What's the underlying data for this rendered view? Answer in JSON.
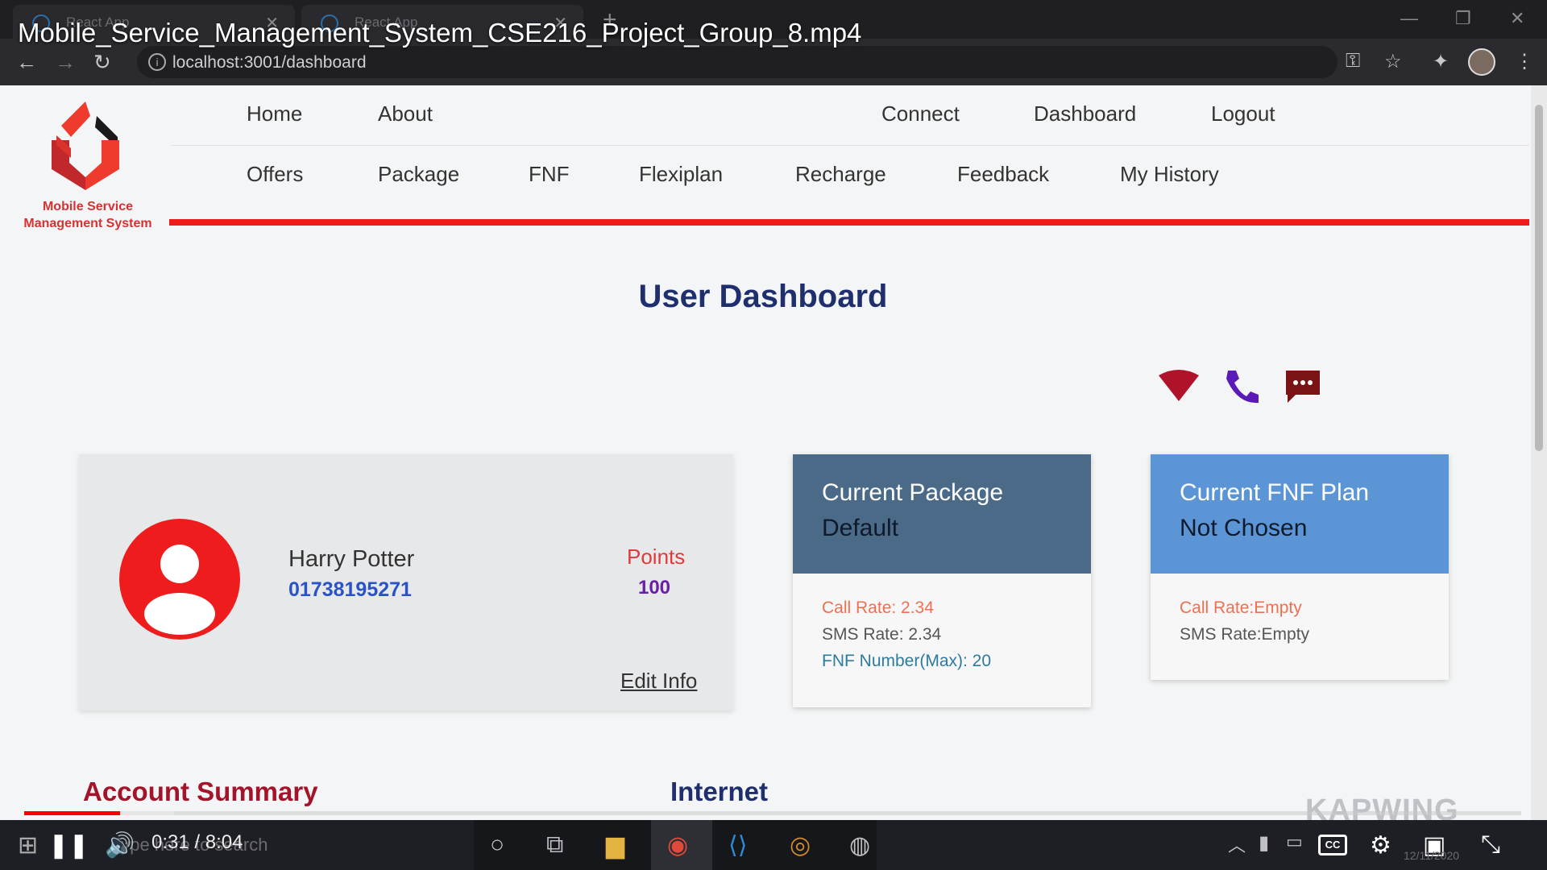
{
  "video": {
    "title": "Mobile_Service_Management_System_CSE216_Project_Group_8.mp4",
    "time": "0:31 / 8:04",
    "progress": 0.064,
    "buffered": 0.1,
    "watermark": "KAPWING"
  },
  "browser": {
    "tabs": [
      {
        "label": "React App"
      },
      {
        "label": "React App"
      }
    ],
    "url": "localhost:3001/dashboard"
  },
  "header": {
    "logo_text_line1": "Mobile Service",
    "logo_text_line2": "Management System",
    "nav_top": [
      "Home",
      "About",
      "Connect",
      "Dashboard",
      "Logout"
    ],
    "nav_bottom": [
      "Offers",
      "Package",
      "FNF",
      "Flexiplan",
      "Recharge",
      "Feedback",
      "My History"
    ]
  },
  "dashboard": {
    "title": "User Dashboard",
    "service_icons": [
      "wifi-icon",
      "phone-icon",
      "message-icon"
    ],
    "profile": {
      "name": "Harry Potter",
      "phone": "01738195271",
      "points_label": "Points",
      "points_value": "100",
      "edit_label": "Edit Info"
    },
    "package": {
      "title": "Current Package",
      "value": "Default",
      "call_rate": "Call Rate: 2.34",
      "sms_rate": "SMS Rate: 2.34",
      "fnf_max": "FNF Number(Max): 20"
    },
    "fnf": {
      "title": "Current FNF Plan",
      "value": "Not Chosen",
      "call_rate": "Call Rate:Empty",
      "sms_rate": "SMS Rate:Empty"
    },
    "sections": [
      "Account Summary",
      "Internet"
    ]
  },
  "taskbar": {
    "search_placeholder": "Type here to search",
    "date": "12/11/2020"
  },
  "colors": {
    "accent_red": "#ee1b1b",
    "title_navy": "#1f2f6e",
    "package_header": "#4a6a87",
    "fnf_header": "#5b95d6"
  }
}
